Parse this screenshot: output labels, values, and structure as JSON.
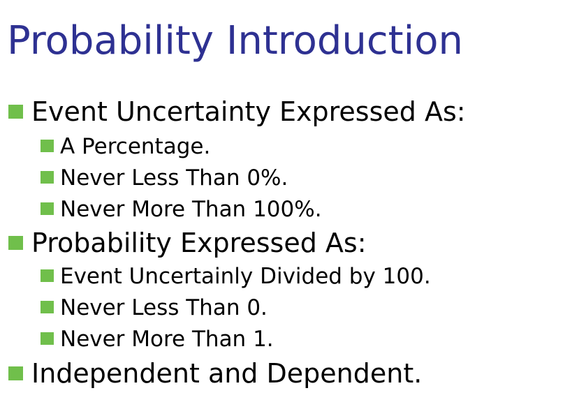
{
  "slide": {
    "title": "Probability Introduction",
    "bullets": [
      {
        "text": "Event Uncertainty Expressed As:",
        "sub": [
          "A Percentage.",
          "Never Less Than 0%.",
          "Never More Than 100%."
        ]
      },
      {
        "text": "Probability Expressed As:",
        "sub": [
          "Event Uncertainly Divided by 100.",
          "Never Less Than 0.",
          "Never More Than 1."
        ]
      },
      {
        "text": "Independent and Dependent.",
        "sub": []
      }
    ]
  },
  "colors": {
    "title": "#2e3192",
    "bullet": "#70bf4b",
    "text": "#000000",
    "background": "#ffffff"
  },
  "icons": {
    "bullet": "green-square-bullet-icon"
  }
}
